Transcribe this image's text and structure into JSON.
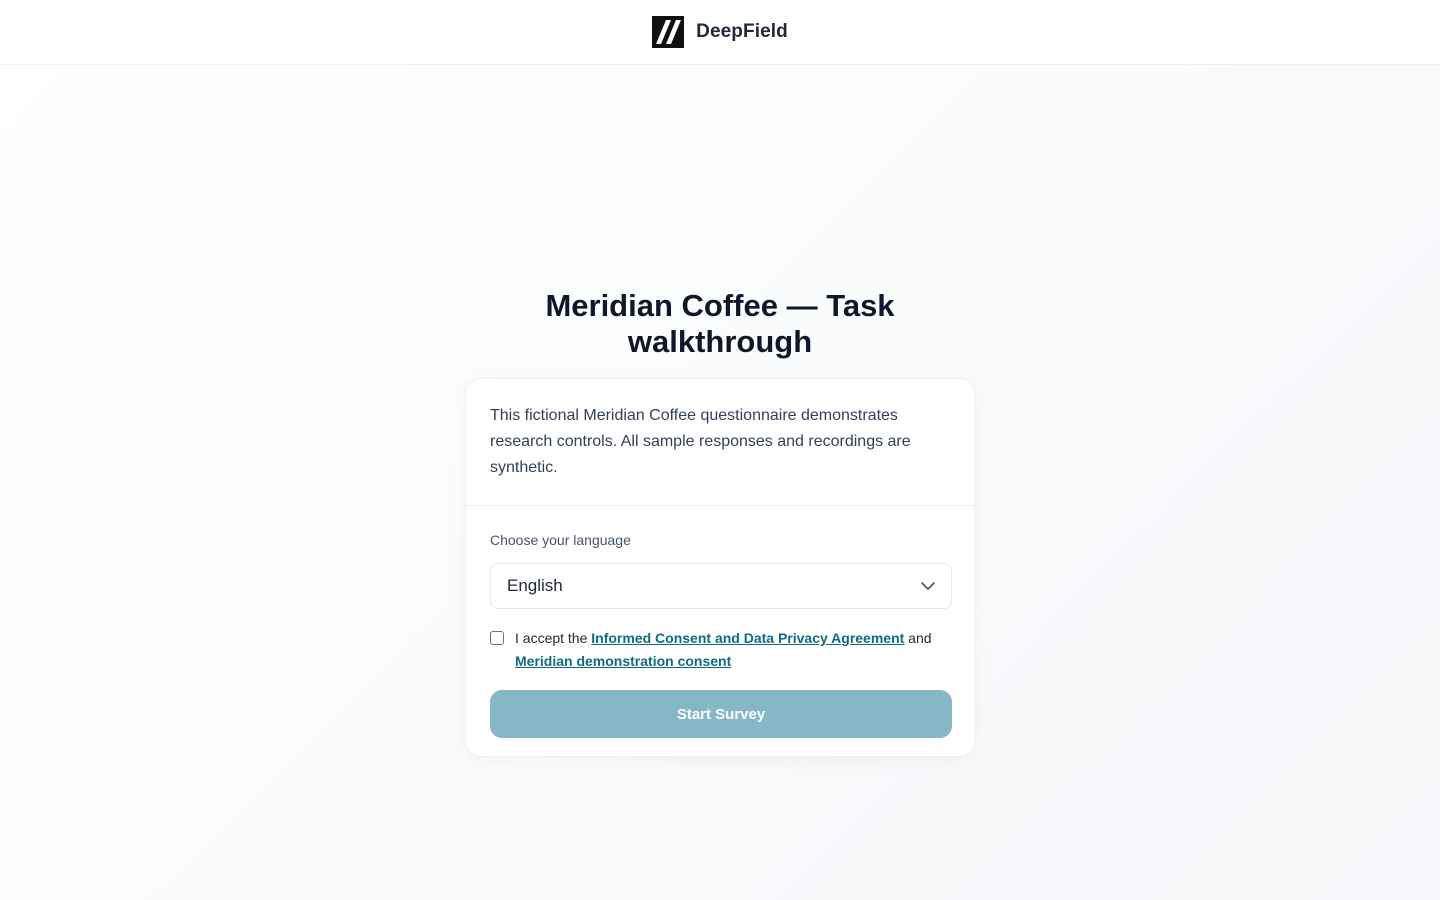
{
  "header": {
    "brand_name": "DeepField",
    "logo_icon": "brand-slash-logo-icon"
  },
  "page": {
    "title": "Meridian Coffee — Task walkthrough"
  },
  "card": {
    "intro": "This fictional Meridian Coffee questionnaire demonstrates research controls. All sample responses and recordings are synthetic.",
    "language": {
      "label": "Choose your language",
      "selected": "English",
      "icon": "chevron-down-icon"
    },
    "consent": {
      "checked": false,
      "prefix": "I accept the ",
      "link1": "Informed Consent and Data Privacy Agreement",
      "middle": " and ",
      "link2": "Meridian demonstration consent"
    },
    "start_button": {
      "label": "Start Survey",
      "disabled": true
    }
  },
  "colors": {
    "button_disabled": "#86b7c6",
    "link": "#0f6b82",
    "title": "#0f172a",
    "logo_bg": "#111111"
  }
}
